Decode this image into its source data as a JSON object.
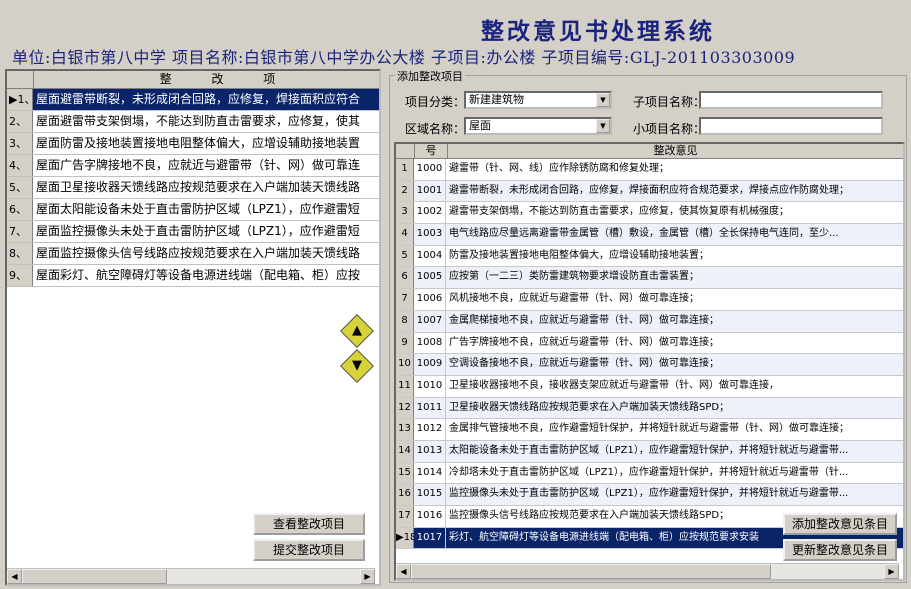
{
  "title": "整改意见书处理系统",
  "info_line": "单位:白银市第八中学 项目名称:白银市第八中学办公大楼 子项目:办公楼 子项目编号:GLJ-201103303009",
  "left_grid": {
    "header": "整 改 项",
    "rows": [
      {
        "num": "▶1、",
        "text": "屋面避雷带断裂，未形成闭合回路，应修复，焊接面积应符合"
      },
      {
        "num": "2、",
        "text": "屋面避雷带支架倒塌，不能达到防直击雷要求，应修复，使其"
      },
      {
        "num": "3、",
        "text": "屋面防雷及接地装置接地电阻整体偏大，应增设辅助接地装置"
      },
      {
        "num": "4、",
        "text": "屋面广告字牌接地不良，应就近与避雷带（针、网）做可靠连"
      },
      {
        "num": "5、",
        "text": "屋面卫星接收器天馈线路应按规范要求在入户端加装天馈线路"
      },
      {
        "num": "6、",
        "text": "屋面太阳能设备未处于直击雷防护区域（LPZ1），应作避雷短"
      },
      {
        "num": "7、",
        "text": "屋面监控摄像头未处于直击雷防护区域（LPZ1），应作避雷短"
      },
      {
        "num": "8、",
        "text": "屋面监控摄像头信号线路应按规范要求在入户端加装天馈线路"
      },
      {
        "num": "9、",
        "text": "屋面彩灯、航空障碍灯等设备电源进线端（配电箱、柜）应按"
      }
    ]
  },
  "buttons": {
    "view": "查看整改项目",
    "submit": "提交整改项目",
    "add": "添加整改意见条目",
    "update": "更新整改意见条目"
  },
  "icons": {
    "move_up": "up-arrow-icon",
    "move_down": "down-arrow-icon"
  },
  "form": {
    "group_title": "添加整改项目",
    "category_label": "项目分类：",
    "category_value": "新建建筑物",
    "area_label": "区域名称：",
    "area_value": "屋面",
    "sub_name_label": "子项目名称：",
    "sub_name_value": "",
    "small_name_label": "小项目名称：",
    "small_name_value": ""
  },
  "right_grid": {
    "col_num": "号",
    "col_opinion": "整改意见",
    "rows": [
      {
        "row": "1",
        "code": "1000",
        "text": "避雷带（针、网、线）应作除锈防腐和修复处理；"
      },
      {
        "row": "2",
        "code": "1001",
        "text": "避雷带断裂，未形成闭合回路，应修复，焊接面积应符合规范要求，焊接点应作防腐处理；"
      },
      {
        "row": "3",
        "code": "1002",
        "text": "避雷带支架倒塌，不能达到防直击雷要求，应修复，使其恢复原有机械强度；"
      },
      {
        "row": "4",
        "code": "1003",
        "text": "电气线路应尽量远离避雷带金属管（槽）敷设，金属管（槽）全长保持电气连同，至少..."
      },
      {
        "row": "5",
        "code": "1004",
        "text": "防雷及接地装置接地电阻整体偏大，应增设辅助接地装置；"
      },
      {
        "row": "6",
        "code": "1005",
        "text": "应按第（一二三）类防雷建筑物要求增设防直击雷装置；"
      },
      {
        "row": "7",
        "code": "1006",
        "text": "风机接地不良，应就近与避雷带（针、网）做可靠连接；"
      },
      {
        "row": "8",
        "code": "1007",
        "text": "金属爬梯接地不良，应就近与避雷带（针、网）做可靠连接；"
      },
      {
        "row": "9",
        "code": "1008",
        "text": "广告字牌接地不良，应就近与避雷带（针、网）做可靠连接；"
      },
      {
        "row": "10",
        "code": "1009",
        "text": "空调设备接地不良，应就近与避雷带（针、网）做可靠连接；"
      },
      {
        "row": "11",
        "code": "1010",
        "text": "卫星接收器接地不良，接收器支架应就近与避雷带（针、网）做可靠连接，"
      },
      {
        "row": "12",
        "code": "1011",
        "text": "卫星接收器天馈线路应按规范要求在入户端加装天馈线路SPD；"
      },
      {
        "row": "13",
        "code": "1012",
        "text": "金属排气管接地不良，应作避雷短针保护，并将短针就近与避雷带（针、网）做可靠连接；"
      },
      {
        "row": "14",
        "code": "1013",
        "text": "太阳能设备未处于直击雷防护区域（LPZ1），应作避雷短针保护，并将短针就近与避雷带..."
      },
      {
        "row": "15",
        "code": "1014",
        "text": "冷却塔未处于直击雷防护区域（LPZ1），应作避雷短针保护，并将短针就近与避雷带（针..."
      },
      {
        "row": "16",
        "code": "1015",
        "text": "监控摄像头未处于直击雷防护区域（LPZ1），应作避雷短针保护，并将短针就近与避雷带..."
      },
      {
        "row": "17",
        "code": "1016",
        "text": "监控摄像头信号线路应按规范要求在入户端加装天馈线路SPD；"
      },
      {
        "row": "▶18",
        "code": "1017",
        "text": "彩灯、航空障碍灯等设备电源进线端（配电箱、柜）应按规范要求安装"
      }
    ]
  }
}
